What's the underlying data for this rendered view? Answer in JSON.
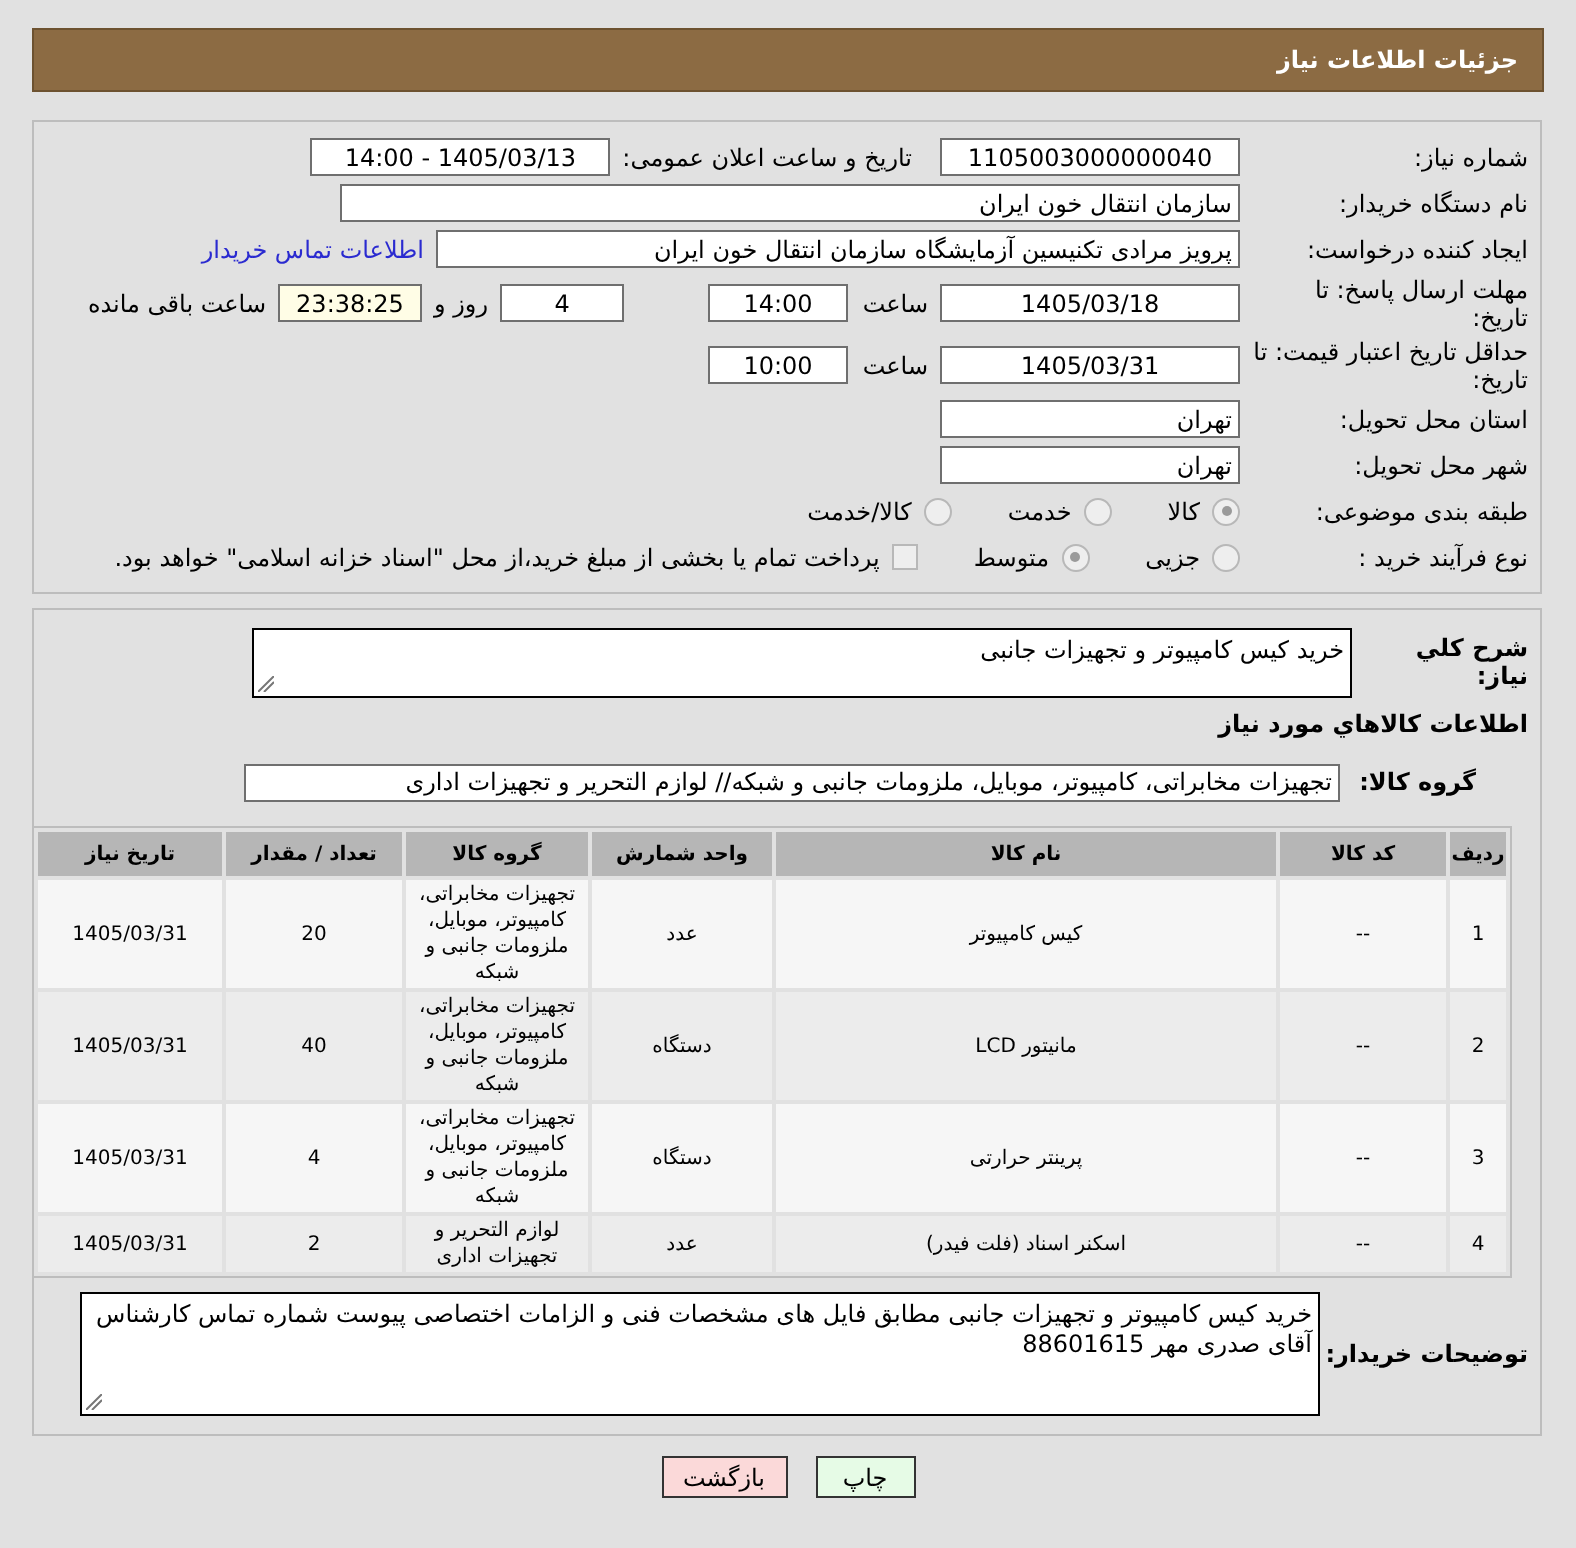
{
  "header": {
    "title": "جزئیات اطلاعات نیاز"
  },
  "need_number": {
    "label": "شماره نیاز:",
    "value": "1105003000000040"
  },
  "announce": {
    "label": "تاریخ و ساعت اعلان عمومی:",
    "value": "1405/03/13 - 14:00"
  },
  "buyer_org": {
    "label": "نام دستگاه خریدار:",
    "value": "سازمان انتقال خون ایران"
  },
  "requester": {
    "label": "ایجاد کننده درخواست:",
    "value": "پرویز مرادی تکنیسین آزمایشگاه سازمان انتقال خون ایران",
    "link": "اطلاعات تماس خریدار"
  },
  "reply_deadline": {
    "label": "مهلت ارسال پاسخ: تا تاریخ:",
    "date": "1405/03/18",
    "time_label": "ساعت",
    "time": "14:00",
    "days": "4",
    "days_label": "روز و",
    "remaining": "23:38:25",
    "remaining_label": "ساعت باقی مانده"
  },
  "price_validity": {
    "label": "حداقل تاریخ اعتبار قیمت: تا تاریخ:",
    "date": "1405/03/31",
    "time_label": "ساعت",
    "time": "10:00"
  },
  "province": {
    "label": "استان محل تحویل:",
    "value": "تهران"
  },
  "city": {
    "label": "شهر محل تحویل:",
    "value": "تهران"
  },
  "classification": {
    "label": "طبقه بندی موضوعی:",
    "options": [
      {
        "label": "کالا",
        "selected": true
      },
      {
        "label": "خدمت",
        "selected": false
      },
      {
        "label": "کالا/خدمت",
        "selected": false
      }
    ]
  },
  "process": {
    "label": "نوع فرآیند خرید :",
    "options": [
      {
        "label": "جزیی",
        "selected": false
      },
      {
        "label": "متوسط",
        "selected": true
      }
    ],
    "payment": {
      "label": "پرداخت تمام یا بخشی از مبلغ خرید،از محل \"اسناد خزانه اسلامی\" خواهد بود.",
      "checked": false
    }
  },
  "summary": {
    "label": "شرح کلي نیاز:",
    "value": "خرید کیس کامپیوتر و تجهیزات جانبی"
  },
  "goods_title": "اطلاعات کالاهاي مورد نیاز",
  "goods_group": {
    "label": "گروه کالا:",
    "value": "تجهیزات مخابراتی، کامپیوتر، موبایل، ملزومات جانبی و شبکه// لوازم التحریر و تجهیزات اداری"
  },
  "table": {
    "columns": [
      "ردیف",
      "کد کالا",
      "نام کالا",
      "واحد شمارش",
      "گروه کالا",
      "تعداد / مقدار",
      "تاریخ نیاز"
    ],
    "rows": [
      [
        "1",
        "--",
        "کیس کامپیوتر",
        "عدد",
        "تجهیزات مخابراتی، کامپیوتر، موبایل، ملزومات جانبی و شبکه",
        "20",
        "1405/03/31"
      ],
      [
        "2",
        "--",
        "مانیتور LCD",
        "دستگاه",
        "تجهیزات مخابراتی، کامپیوتر، موبایل، ملزومات جانبی و شبکه",
        "40",
        "1405/03/31"
      ],
      [
        "3",
        "--",
        "پرینتر حرارتی",
        "دستگاه",
        "تجهیزات مخابراتی، کامپیوتر، موبایل، ملزومات جانبی و شبکه",
        "4",
        "1405/03/31"
      ],
      [
        "4",
        "--",
        "اسکنر اسناد (فلت فیدر)",
        "عدد",
        "لوازم التحریر و تجهیزات اداری",
        "2",
        "1405/03/31"
      ]
    ]
  },
  "buyer_notes": {
    "label": "توضیحات خریدار:",
    "value": "خرید کیس کامپیوتر و تجهیزات جانبی مطابق فایل های مشخصات فنی و الزامات اختصاصی پیوست شماره تماس کارشناس آقای صدری مهر 88601615"
  },
  "buttons": [
    {
      "label": "چاپ",
      "kind": "print"
    },
    {
      "label": "بازگشت",
      "kind": "back"
    }
  ]
}
